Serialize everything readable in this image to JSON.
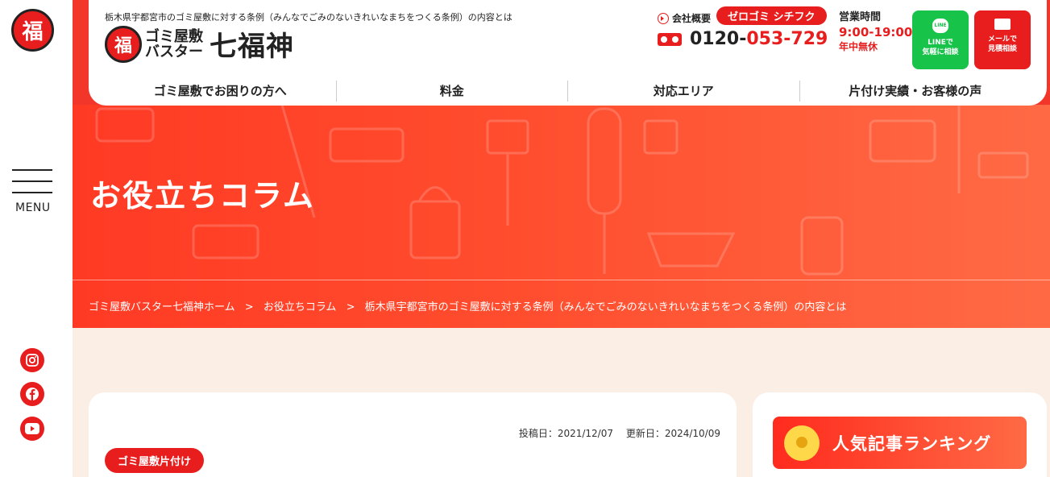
{
  "site": {
    "tagline": "栃木県宇都宮市のゴミ屋敷に対する条例（みんなでごみのないきれいなまちをつくる条例）の内容とは",
    "logo_mark": "福",
    "brand_sub_line1": "ゴミ屋敷",
    "brand_sub_line2": "バスター",
    "brand_main": "七福神"
  },
  "header": {
    "company_link": "会社概要",
    "pill_label": "ゼロゴミ シチフク",
    "phone_prefix": "0120-",
    "phone_suffix": "053-729",
    "hours_label": "営業時間",
    "hours_value": "9:00-19:00",
    "hours_note": "年中無休",
    "cta_line_1": "LINEで",
    "cta_line_2": "気軽に相談",
    "cta_mail_1": "メールで",
    "cta_mail_2": "見積相談",
    "line_icon_text": "LINE"
  },
  "nav": {
    "items": [
      {
        "label": "ゴミ屋敷でお困りの方へ"
      },
      {
        "label": "料金"
      },
      {
        "label": "対応エリア"
      },
      {
        "label": "片付け実績・お客様の声"
      }
    ]
  },
  "rail": {
    "menu_label": "MENU",
    "logo_mark": "福"
  },
  "hero": {
    "title": "お役立ちコラム"
  },
  "breadcrumb": {
    "home": "ゴミ屋敷バスター七福神ホーム",
    "sep": ">",
    "column": "お役立ちコラム",
    "current": "栃木県宇都宮市のゴミ屋敷に対する条例（みんなでごみのないきれいなまちをつくる条例）の内容とは"
  },
  "article": {
    "posted": "投稿日：2021/12/07",
    "updated": "更新日：2024/10/09",
    "category": "ゴミ屋敷片付け"
  },
  "sidebar": {
    "ranking_title": "人気記事ランキング"
  },
  "colors": {
    "brand_red": "#e81d1d",
    "line_green": "#18c34a",
    "bg_cream": "#fbeee4"
  }
}
